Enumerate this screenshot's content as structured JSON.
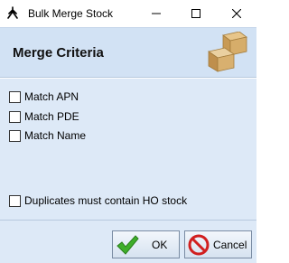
{
  "window": {
    "title": "Bulk Merge Stock",
    "app_icon": "stick-figure-icon"
  },
  "header": {
    "title": "Merge Criteria",
    "icon": "boxes-icon"
  },
  "criteria": [
    {
      "label": "Match APN",
      "checked": false
    },
    {
      "label": "Match PDE",
      "checked": false
    },
    {
      "label": "Match Name",
      "checked": false
    }
  ],
  "duplicates_option": {
    "label": "Duplicates must contain HO stock",
    "checked": false
  },
  "buttons": {
    "ok": {
      "label": "OK",
      "icon": "checkmark-icon"
    },
    "cancel": {
      "label": "Cancel",
      "icon": "cancel-icon"
    }
  },
  "colors": {
    "panel_background": "#dde9f7",
    "header_background": "#d2e2f4",
    "ok_icon": "#3fae2a",
    "cancel_icon": "#d11f1f"
  }
}
